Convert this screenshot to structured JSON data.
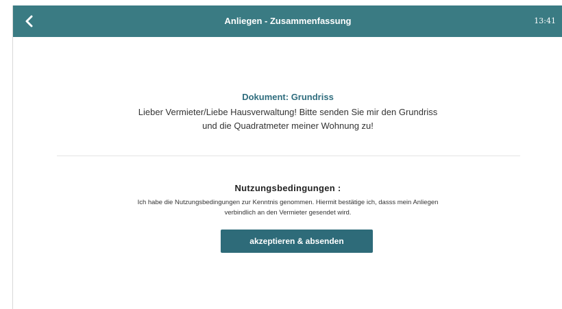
{
  "header": {
    "title": "Anliegen - Zusammenfassung",
    "time": "13:41",
    "back_icon": "chevron-left-icon"
  },
  "document": {
    "heading": "Dokument: Grundriss",
    "text": "Lieber Vermieter/Liebe Hausverwaltung! Bitte senden Sie mir den Grundriss und die Quadratmeter meiner Wohnung zu!"
  },
  "terms": {
    "heading": "Nutzungsbedingungen :",
    "text": "Ich habe die Nutzungsbedingungen zur Kenntnis genommen. Hiermit bestätige ich, dasss mein Anliegen verbindlich an den Vermieter gesendet wird."
  },
  "actions": {
    "accept_label": "akzeptieren & absenden"
  },
  "colors": {
    "header_bg": "#3a7b83",
    "accent_text": "#2f6d7e",
    "button_bg": "#2e6b79"
  }
}
